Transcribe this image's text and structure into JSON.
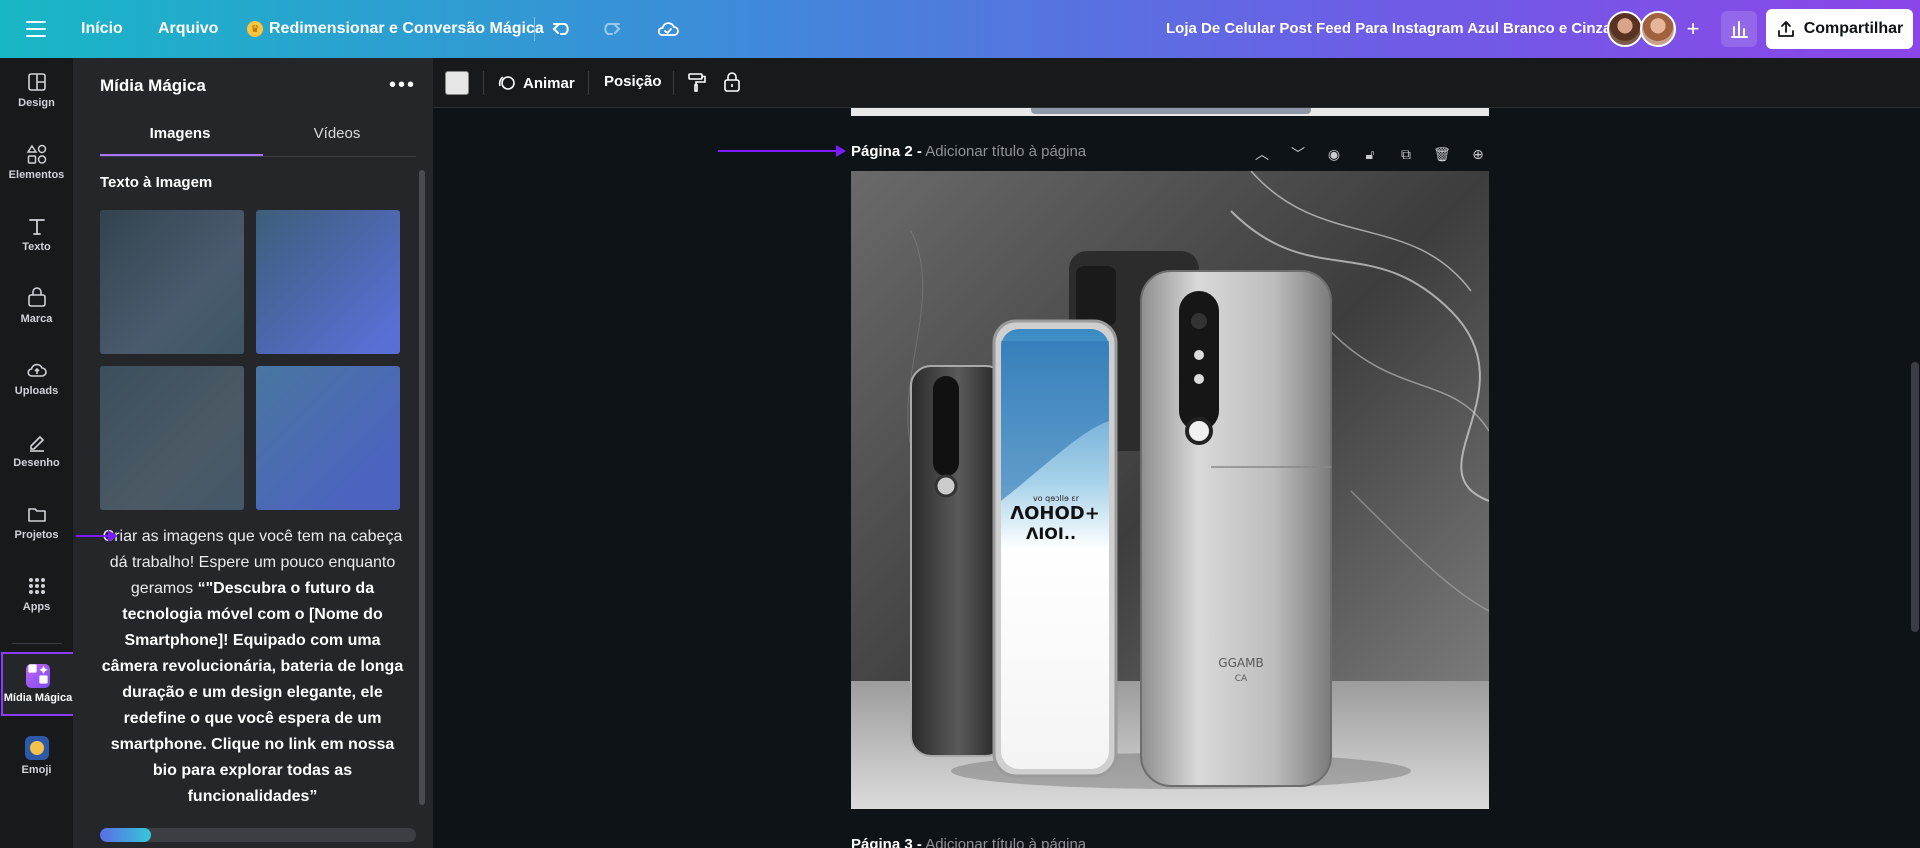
{
  "topbar": {
    "home": "Início",
    "file": "Arquivo",
    "magic_resize": "Redimensionar e Conversão Mágica",
    "doc_title": "Loja De Celular Post Feed Para Instagram Azul Branco e Cinza",
    "share": "Compartilhar",
    "add": "+"
  },
  "rail": {
    "items": [
      {
        "label": "Design"
      },
      {
        "label": "Elementos"
      },
      {
        "label": "Texto"
      },
      {
        "label": "Marca"
      },
      {
        "label": "Uploads"
      },
      {
        "label": "Desenho"
      },
      {
        "label": "Projetos"
      },
      {
        "label": "Apps"
      },
      {
        "label": "Mídia Mágica"
      },
      {
        "label": "Emoji"
      }
    ]
  },
  "panel": {
    "title": "Mídia Mágica",
    "menu": "•••",
    "tabs": [
      {
        "label": "Imagens"
      },
      {
        "label": "Vídeos"
      }
    ],
    "section": "Texto à Imagem",
    "generating_intro": "Criar as imagens que você tem na cabeça dá trabalho! Espere um pouco enquanto geramos ",
    "generating_prompt": "“\"Descubra o futuro da tecnologia móvel com o [Nome do Smartphone]! Equipado com uma câmera revolucionária, bateria de longa duração e um design elegante, ele redefine o que você espera de um smartphone. Clique no link em nossa bio para explorar todas as funcionalidades”",
    "progress": 0.16
  },
  "toolbar": {
    "animate": "Animar",
    "position": "Posição",
    "swatch_color": "#e6e6e6"
  },
  "canvas": {
    "pages": [
      {
        "label": "Página 2 -",
        "add_title": "Adicionar título à página"
      },
      {
        "label": "Página 3 -",
        "add_title": "Adicionar título à página"
      }
    ],
    "phone_text": {
      "screen_line1": "ɅOHOD+",
      "screen_line2": "ɅIOI..",
      "screen_small": "vo qɘɔllɘ ɛr",
      "back_text": "GGAMB",
      "back_text2": "CA"
    }
  },
  "colors": {
    "accent": "#8b3dff",
    "arrow": "#7a1cff",
    "panel_bg": "#25262a",
    "canvas_bg": "#0e1318"
  }
}
